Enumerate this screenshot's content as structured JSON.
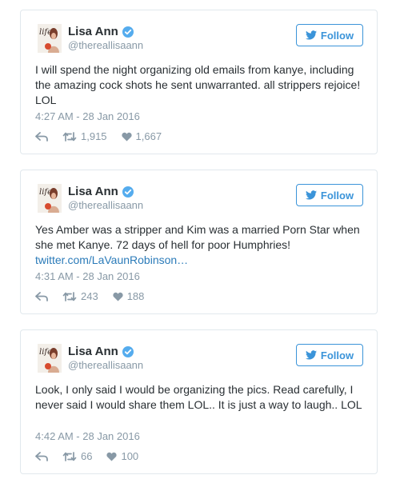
{
  "tweets": [
    {
      "name": "Lisa Ann",
      "handle": "@thereallisaann",
      "follow_label": "Follow",
      "text": "I will spend the night organizing old emails from kanye, including the amazing cock shots he sent unwarranted. all strippers rejoice! LOL",
      "link": "",
      "timestamp": "4:27 AM - 28 Jan 2016",
      "retweets": "1,915",
      "likes": "1,667"
    },
    {
      "name": "Lisa Ann",
      "handle": "@thereallisaann",
      "follow_label": "Follow",
      "text": "Yes Amber was a stripper and Kim was a married Porn Star when she met Kanye. 72 days of hell for poor Humphries!",
      "link": "twitter.com/LaVaunRobinson…",
      "timestamp": "4:31 AM - 28 Jan 2016",
      "retweets": "243",
      "likes": "188"
    },
    {
      "name": "Lisa Ann",
      "handle": "@thereallisaann",
      "follow_label": "Follow",
      "text": "Look, I only said I would be organizing the pics. Read carefully, I never said I would share them LOL.. It is just a way to laugh.. LOL",
      "link": "",
      "timestamp": "4:42 AM - 28 Jan 2016",
      "retweets": "66",
      "likes": "100"
    }
  ],
  "colors": {
    "accent": "#3b94d9",
    "link": "#2b7bb9",
    "muted": "#8899a6",
    "text": "#292f33",
    "border": "#e1e8ed"
  },
  "icons": {
    "verified": "verified-badge-icon",
    "follow": "twitter-bird-icon",
    "reply": "reply-icon",
    "retweet": "retweet-icon",
    "like": "heart-icon",
    "avatar": "profile-avatar"
  },
  "avatar_text": "life"
}
